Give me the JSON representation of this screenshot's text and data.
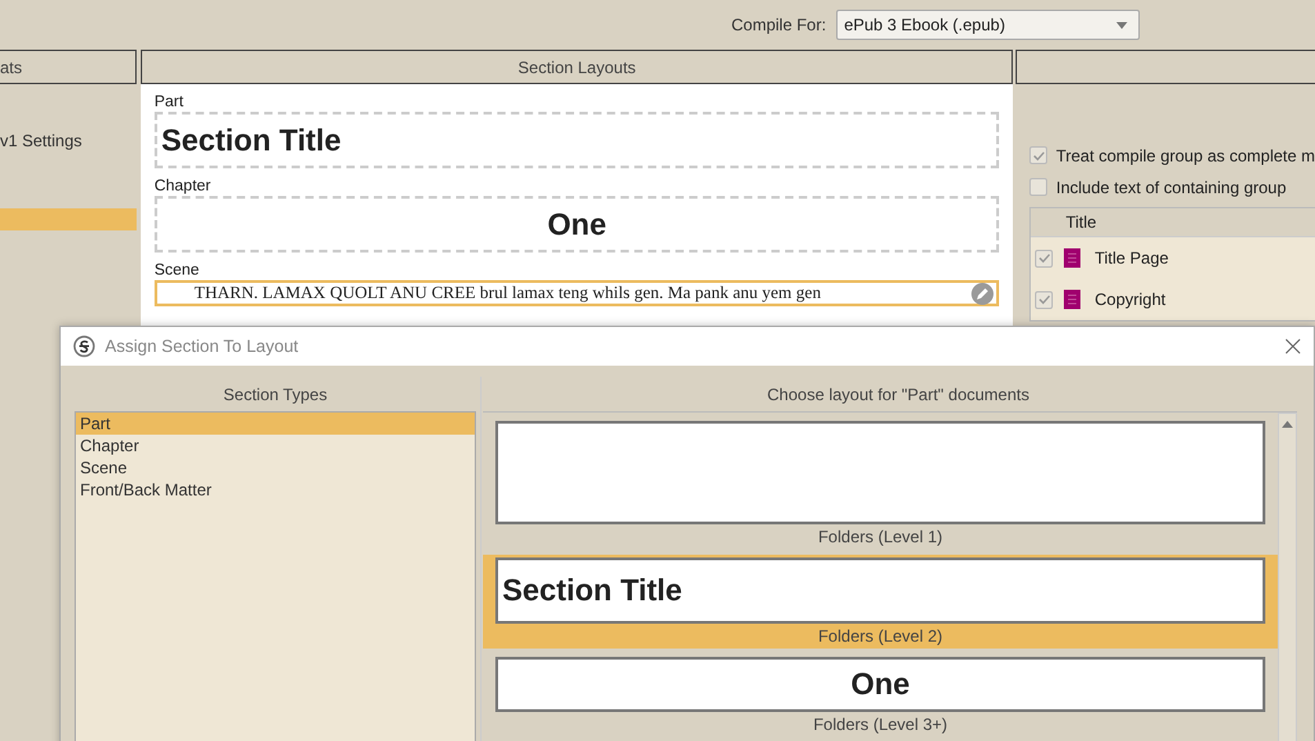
{
  "compile_for": {
    "label": "Compile For:",
    "value": "ePub 3 Ebook (.epub)"
  },
  "formats_column": {
    "header": "ats",
    "rows": [
      {
        "label": "v1 Settings",
        "selected": false
      },
      {
        "selected": true
      }
    ]
  },
  "section_layouts": {
    "header": "Section Layouts",
    "sections": [
      {
        "label": "Part",
        "kind": "title-left",
        "preview": "Section Title",
        "selected": false
      },
      {
        "label": "Chapter",
        "kind": "title-center",
        "preview": "One",
        "selected": false
      },
      {
        "label": "Scene",
        "kind": "prose",
        "preview": "THARN. LAMAX QUOLT ANU CREE brul lamax teng whils gen. Ma pank anu yem gen",
        "selected": true
      }
    ]
  },
  "options": {
    "checkboxes": [
      {
        "label": "Treat compile group as complete m",
        "checked": true
      },
      {
        "label": "Include text of containing group",
        "checked": false
      }
    ]
  },
  "contents_table": {
    "columns": [
      "Title"
    ],
    "rows": [
      {
        "title": "Title Page",
        "checked": true
      },
      {
        "title": "Copyright",
        "checked": true
      }
    ]
  },
  "dialog": {
    "title": "Assign Section To Layout",
    "section_types": {
      "header": "Section Types",
      "items": [
        {
          "label": "Part",
          "selected": true
        },
        {
          "label": "Chapter",
          "selected": false
        },
        {
          "label": "Scene",
          "selected": false
        },
        {
          "label": "Front/Back Matter",
          "selected": false
        }
      ]
    },
    "layouts": {
      "header": "Choose layout for \"Part\" documents",
      "items": [
        {
          "name": "Folders (Level 1)",
          "kind": "blank",
          "selected": false
        },
        {
          "name": "Folders (Level 2)",
          "kind": "title-left",
          "preview": "Section Title",
          "selected": true
        },
        {
          "name": "Folders (Level 3+)",
          "kind": "title-center",
          "preview": "One",
          "selected": false
        }
      ]
    }
  }
}
